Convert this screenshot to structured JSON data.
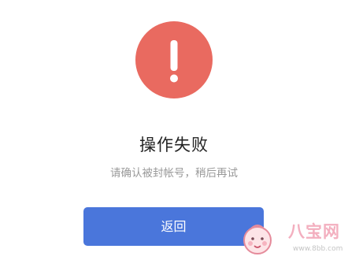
{
  "status": {
    "icon": "exclamation-icon",
    "icon_color": "#e96a60",
    "title": "操作失败",
    "message": "请确认被封帐号，稍后再试"
  },
  "actions": {
    "back_label": "返回",
    "button_color": "#4a76db"
  },
  "watermark": {
    "brand": "八宝网",
    "url": "www.8bb.com"
  }
}
